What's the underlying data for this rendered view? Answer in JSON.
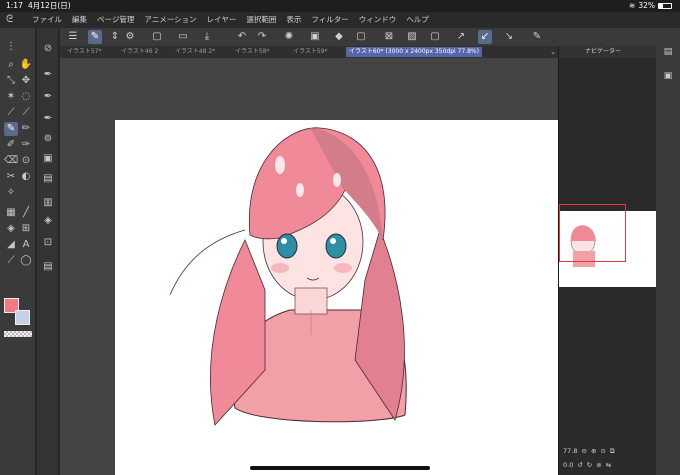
{
  "status": {
    "time": "1:17",
    "date": "4月12日(日)",
    "battery": "32%"
  },
  "menu": {
    "items": [
      "ファイル",
      "編集",
      "ページ管理",
      "アニメーション",
      "レイヤー",
      "選択範囲",
      "表示",
      "フィルター",
      "ウィンドウ",
      "ヘルプ"
    ]
  },
  "tabs": [
    {
      "label": "イラスト57*"
    },
    {
      "label": "イラスト46 2"
    },
    {
      "label": "イラスト48 2*"
    },
    {
      "label": "イラスト58*"
    },
    {
      "label": "イラスト59*"
    },
    {
      "label": "イラスト60* (3000 x 2400px 350dpi 77.8%)"
    }
  ],
  "navigator": {
    "title": "ナビゲーター",
    "zoom": "77.8",
    "rotation": "0.0"
  },
  "colors": {
    "main": "#f07a7f",
    "sub": "#c7cfe6",
    "accent": "#5566aa"
  },
  "icons": {
    "status": [
      "wifi-icon",
      "battery-icon"
    ],
    "command": [
      "menu-icon",
      "pen-setting-icon",
      "settings-icon",
      "new-icon",
      "open-icon",
      "save-icon",
      "undo-icon",
      "redo-icon",
      "clear-icon",
      "fill-icon",
      "transform-icon",
      "ruler-icon",
      "brush-icon",
      "edit-icon"
    ]
  }
}
